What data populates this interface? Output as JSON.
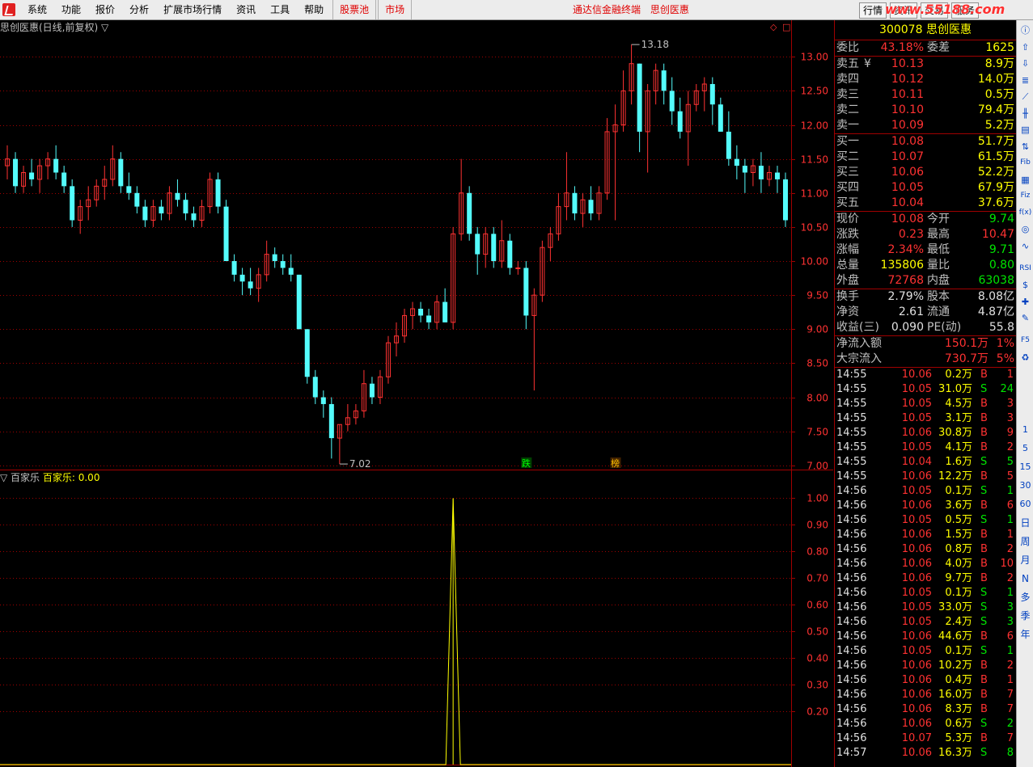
{
  "menu": {
    "items": [
      "系统",
      "功能",
      "报价",
      "分析",
      "扩展市场行情",
      "资讯",
      "工具",
      "帮助"
    ],
    "highlight_items": [
      "股票池",
      "市场"
    ],
    "center_text": [
      "通达信金融终端",
      "思创医惠"
    ],
    "right_buttons": [
      "行情",
      "资讯",
      "交易",
      "服务"
    ],
    "watermark": "www.55188.com"
  },
  "chart": {
    "title": "思创医惠(日线,前复权) ▽",
    "sub_title_prefix": "▽ 百家乐",
    "sub_title_value": "百家乐: 0.00",
    "high_mark": "13.18",
    "low_mark": "7.02",
    "mark_die": "跌",
    "mark_bang": "榜",
    "price_axis": [
      "13.00",
      "12.50",
      "12.00",
      "11.50",
      "11.00",
      "10.50",
      "10.00",
      "9.50",
      "9.00",
      "8.50",
      "8.00",
      "7.50",
      "7.00"
    ],
    "sub_axis": [
      "1.00",
      "0.90",
      "0.80",
      "0.70",
      "0.60",
      "0.50",
      "0.40",
      "0.30",
      "0.20"
    ]
  },
  "chart_data": {
    "type": "candlestick",
    "price_range": [
      6.95,
      13.3
    ],
    "candles": [
      [
        11.4,
        11.7,
        11.2,
        11.5
      ],
      [
        11.5,
        11.6,
        11.0,
        11.1
      ],
      [
        11.1,
        11.4,
        11.0,
        11.3
      ],
      [
        11.3,
        11.5,
        11.1,
        11.2
      ],
      [
        11.2,
        11.5,
        11.0,
        11.4
      ],
      [
        11.4,
        11.6,
        11.2,
        11.5
      ],
      [
        11.5,
        11.7,
        11.2,
        11.3
      ],
      [
        11.3,
        11.4,
        11.0,
        11.1
      ],
      [
        11.1,
        11.2,
        10.5,
        10.6
      ],
      [
        10.6,
        10.9,
        10.4,
        10.8
      ],
      [
        10.8,
        11.1,
        10.6,
        10.9
      ],
      [
        10.9,
        11.2,
        10.8,
        11.1
      ],
      [
        11.1,
        11.4,
        10.9,
        11.2
      ],
      [
        11.2,
        11.7,
        11.1,
        11.5
      ],
      [
        11.5,
        11.6,
        11.0,
        11.1
      ],
      [
        11.1,
        11.3,
        10.9,
        11.0
      ],
      [
        11.0,
        11.1,
        10.7,
        10.8
      ],
      [
        10.8,
        10.9,
        10.5,
        10.6
      ],
      [
        10.6,
        10.9,
        10.5,
        10.8
      ],
      [
        10.8,
        10.9,
        10.6,
        10.7
      ],
      [
        10.7,
        11.1,
        10.6,
        11.0
      ],
      [
        11.0,
        11.2,
        10.8,
        10.9
      ],
      [
        10.9,
        11.0,
        10.6,
        10.7
      ],
      [
        10.7,
        10.8,
        10.5,
        10.6
      ],
      [
        10.6,
        10.9,
        10.5,
        10.8
      ],
      [
        10.8,
        11.3,
        10.7,
        11.2
      ],
      [
        11.2,
        11.3,
        10.7,
        10.8
      ],
      [
        10.8,
        10.9,
        10.0,
        10.0
      ],
      [
        10.0,
        10.1,
        9.7,
        9.8
      ],
      [
        9.8,
        9.9,
        9.5,
        9.7
      ],
      [
        9.7,
        9.9,
        9.5,
        9.6
      ],
      [
        9.6,
        9.9,
        9.4,
        9.8
      ],
      [
        9.8,
        10.3,
        9.7,
        10.1
      ],
      [
        10.1,
        10.2,
        9.9,
        10.0
      ],
      [
        10.0,
        10.1,
        9.8,
        9.9
      ],
      [
        9.9,
        10.1,
        9.7,
        9.8
      ],
      [
        9.8,
        9.8,
        9.0,
        9.0
      ],
      [
        9.0,
        9.0,
        8.2,
        8.3
      ],
      [
        8.3,
        8.4,
        7.9,
        8.0
      ],
      [
        8.0,
        8.1,
        7.7,
        7.9
      ],
      [
        7.9,
        8.0,
        7.1,
        7.4
      ],
      [
        7.4,
        7.6,
        7.02,
        7.6
      ],
      [
        7.6,
        7.9,
        7.5,
        7.7
      ],
      [
        7.7,
        7.9,
        7.6,
        7.8
      ],
      [
        7.8,
        8.4,
        7.7,
        8.2
      ],
      [
        8.2,
        8.3,
        7.9,
        8.0
      ],
      [
        8.0,
        8.4,
        7.9,
        8.3
      ],
      [
        8.3,
        8.9,
        8.2,
        8.8
      ],
      [
        8.8,
        9.1,
        8.6,
        8.9
      ],
      [
        8.9,
        9.3,
        8.8,
        9.2
      ],
      [
        9.2,
        9.4,
        9.0,
        9.3
      ],
      [
        9.3,
        9.4,
        9.1,
        9.2
      ],
      [
        9.2,
        9.3,
        9.0,
        9.1
      ],
      [
        9.1,
        9.5,
        9.0,
        9.4
      ],
      [
        9.4,
        9.6,
        9.1,
        9.1
      ],
      [
        9.1,
        10.5,
        9.0,
        10.4
      ],
      [
        10.4,
        11.5,
        10.3,
        11.0
      ],
      [
        11.0,
        11.1,
        10.3,
        10.4
      ],
      [
        10.4,
        10.5,
        9.8,
        10.1
      ],
      [
        10.1,
        10.5,
        9.9,
        10.4
      ],
      [
        10.4,
        10.5,
        9.9,
        10.0
      ],
      [
        10.0,
        10.6,
        9.9,
        10.3
      ],
      [
        10.3,
        10.4,
        9.8,
        9.9
      ],
      [
        9.9,
        10.0,
        9.8,
        9.9
      ],
      [
        9.9,
        10.0,
        9.0,
        9.2
      ],
      [
        9.2,
        9.6,
        8.1,
        9.5
      ],
      [
        9.5,
        10.3,
        9.4,
        10.2
      ],
      [
        10.2,
        10.5,
        10.0,
        10.4
      ],
      [
        10.4,
        11.0,
        10.3,
        10.8
      ],
      [
        10.8,
        11.6,
        10.6,
        11.0
      ],
      [
        11.0,
        11.1,
        10.6,
        10.7
      ],
      [
        10.7,
        11.0,
        10.5,
        10.9
      ],
      [
        10.9,
        11.1,
        10.6,
        10.7
      ],
      [
        10.7,
        11.1,
        10.6,
        11.0
      ],
      [
        11.0,
        12.1,
        10.9,
        11.9
      ],
      [
        11.9,
        12.3,
        10.6,
        12.0
      ],
      [
        12.0,
        12.8,
        11.9,
        12.5
      ],
      [
        12.5,
        13.18,
        12.3,
        12.9
      ],
      [
        12.9,
        12.9,
        11.6,
        11.9
      ],
      [
        11.9,
        12.6,
        11.3,
        12.5
      ],
      [
        12.5,
        12.9,
        12.3,
        12.8
      ],
      [
        12.8,
        12.9,
        12.3,
        12.5
      ],
      [
        12.5,
        12.7,
        12.0,
        12.2
      ],
      [
        12.2,
        12.4,
        11.8,
        11.9
      ],
      [
        11.9,
        12.5,
        11.4,
        12.3
      ],
      [
        12.3,
        12.6,
        12.2,
        12.5
      ],
      [
        12.5,
        12.7,
        12.2,
        12.6
      ],
      [
        12.6,
        12.7,
        12.0,
        12.3
      ],
      [
        12.3,
        12.4,
        11.9,
        11.9
      ],
      [
        11.9,
        12.2,
        11.4,
        11.5
      ],
      [
        11.5,
        11.7,
        11.2,
        11.4
      ],
      [
        11.4,
        11.5,
        11.0,
        11.3
      ],
      [
        11.3,
        11.5,
        11.1,
        11.4
      ],
      [
        11.4,
        11.6,
        11.0,
        11.2
      ],
      [
        11.2,
        11.4,
        11.1,
        11.3
      ],
      [
        11.3,
        11.4,
        11.0,
        11.2
      ],
      [
        11.2,
        11.3,
        10.5,
        10.6
      ]
    ],
    "indicator_spike": {
      "index": 55,
      "value": 1.0
    },
    "indicator_range": [
      0,
      1.05
    ]
  },
  "quote": {
    "code": "300078",
    "name": "思创医惠",
    "weibi_label": "委比",
    "weibi_value": "43.18%",
    "weicha_label": "委差",
    "weicha_value": "1625",
    "sells": [
      {
        "label": "卖五",
        "mark": "¥",
        "price": "10.13",
        "vol": "8.9万"
      },
      {
        "label": "卖四",
        "mark": "",
        "price": "10.12",
        "vol": "14.0万"
      },
      {
        "label": "卖三",
        "mark": "",
        "price": "10.11",
        "vol": "0.5万"
      },
      {
        "label": "卖二",
        "mark": "",
        "price": "10.10",
        "vol": "79.4万"
      },
      {
        "label": "卖一",
        "mark": "",
        "price": "10.09",
        "vol": "5.2万"
      }
    ],
    "buys": [
      {
        "label": "买一",
        "price": "10.08",
        "vol": "51.7万"
      },
      {
        "label": "买二",
        "price": "10.07",
        "vol": "61.5万"
      },
      {
        "label": "买三",
        "price": "10.06",
        "vol": "52.2万"
      },
      {
        "label": "买四",
        "price": "10.05",
        "vol": "67.9万"
      },
      {
        "label": "买五",
        "price": "10.04",
        "vol": "37.6万"
      }
    ],
    "stats": [
      {
        "l1": "现价",
        "v1": "10.08",
        "c1": "red",
        "l2": "今开",
        "v2": "9.74",
        "c2": "green"
      },
      {
        "l1": "涨跌",
        "v1": "0.23",
        "c1": "red",
        "l2": "最高",
        "v2": "10.47",
        "c2": "red"
      },
      {
        "l1": "涨幅",
        "v1": "2.34%",
        "c1": "red",
        "l2": "最低",
        "v2": "9.71",
        "c2": "green"
      },
      {
        "l1": "总量",
        "v1": "135806",
        "c1": "yellow",
        "l2": "量比",
        "v2": "0.80",
        "c2": "green"
      },
      {
        "l1": "外盘",
        "v1": "72768",
        "c1": "red",
        "l2": "内盘",
        "v2": "63038",
        "c2": "green"
      }
    ],
    "stats2": [
      {
        "l1": "换手",
        "v1": "2.79%",
        "l2": "股本",
        "v2": "8.08亿"
      },
      {
        "l1": "净资",
        "v1": "2.61",
        "l2": "流通",
        "v2": "4.87亿"
      },
      {
        "l1": "收益(三)",
        "v1": "0.090",
        "l2": "PE(动)",
        "v2": "55.8"
      }
    ],
    "flow": [
      {
        "label": "净流入额",
        "value": "150.1万",
        "pct": "1%"
      },
      {
        "label": "大宗流入",
        "value": "730.7万",
        "pct": "5%"
      }
    ],
    "ticks": [
      {
        "t": "14:55",
        "p": "10.06",
        "v": "0.2万",
        "d": "B",
        "n": "1"
      },
      {
        "t": "14:55",
        "p": "10.05",
        "v": "31.0万",
        "d": "S",
        "n": "24"
      },
      {
        "t": "14:55",
        "p": "10.05",
        "v": "4.5万",
        "d": "B",
        "n": "3"
      },
      {
        "t": "14:55",
        "p": "10.05",
        "v": "3.1万",
        "d": "B",
        "n": "3"
      },
      {
        "t": "14:55",
        "p": "10.06",
        "v": "30.8万",
        "d": "B",
        "n": "9"
      },
      {
        "t": "14:55",
        "p": "10.05",
        "v": "4.1万",
        "d": "B",
        "n": "2"
      },
      {
        "t": "14:55",
        "p": "10.04",
        "v": "1.6万",
        "d": "S",
        "n": "5"
      },
      {
        "t": "14:55",
        "p": "10.06",
        "v": "12.2万",
        "d": "B",
        "n": "5"
      },
      {
        "t": "14:56",
        "p": "10.05",
        "v": "0.1万",
        "d": "S",
        "n": "1"
      },
      {
        "t": "14:56",
        "p": "10.06",
        "v": "3.6万",
        "d": "B",
        "n": "6"
      },
      {
        "t": "14:56",
        "p": "10.05",
        "v": "0.5万",
        "d": "S",
        "n": "1"
      },
      {
        "t": "14:56",
        "p": "10.06",
        "v": "1.5万",
        "d": "B",
        "n": "1"
      },
      {
        "t": "14:56",
        "p": "10.06",
        "v": "0.8万",
        "d": "B",
        "n": "2"
      },
      {
        "t": "14:56",
        "p": "10.06",
        "v": "4.0万",
        "d": "B",
        "n": "10"
      },
      {
        "t": "14:56",
        "p": "10.06",
        "v": "9.7万",
        "d": "B",
        "n": "2"
      },
      {
        "t": "14:56",
        "p": "10.05",
        "v": "0.1万",
        "d": "S",
        "n": "1"
      },
      {
        "t": "14:56",
        "p": "10.05",
        "v": "33.0万",
        "d": "S",
        "n": "3"
      },
      {
        "t": "14:56",
        "p": "10.05",
        "v": "2.4万",
        "d": "S",
        "n": "3"
      },
      {
        "t": "14:56",
        "p": "10.06",
        "v": "44.6万",
        "d": "B",
        "n": "6"
      },
      {
        "t": "14:56",
        "p": "10.05",
        "v": "0.1万",
        "d": "S",
        "n": "1"
      },
      {
        "t": "14:56",
        "p": "10.06",
        "v": "10.2万",
        "d": "B",
        "n": "2"
      },
      {
        "t": "14:56",
        "p": "10.06",
        "v": "0.4万",
        "d": "B",
        "n": "1"
      },
      {
        "t": "14:56",
        "p": "10.06",
        "v": "16.0万",
        "d": "B",
        "n": "7"
      },
      {
        "t": "14:56",
        "p": "10.06",
        "v": "8.3万",
        "d": "B",
        "n": "7"
      },
      {
        "t": "14:56",
        "p": "10.06",
        "v": "0.6万",
        "d": "S",
        "n": "2"
      },
      {
        "t": "14:56",
        "p": "10.07",
        "v": "5.3万",
        "d": "B",
        "n": "7"
      },
      {
        "t": "14:57",
        "p": "10.06",
        "v": "16.3万",
        "d": "S",
        "n": "8"
      }
    ]
  },
  "toolbar": {
    "periods": [
      "1",
      "5",
      "15",
      "30",
      "60"
    ],
    "period_words": [
      "日",
      "周",
      "月",
      "N",
      "多",
      "季",
      "年"
    ],
    "icons": [
      "info-icon",
      "up-arrow-icon",
      "down-arrow-icon",
      "list-icon",
      "line-chart-icon",
      "kline-icon",
      "grid-icon",
      "sort-icon",
      "fib-icon",
      "calendar-icon",
      "fiz-icon",
      "fx-icon",
      "circle-icon",
      "wave-icon",
      "rsi-icon",
      "money-icon",
      "cross-icon",
      "pencil-icon",
      "f5-icon",
      "recycle-icon"
    ],
    "icon_labels": {
      "fib": "Fib",
      "fiz": "Fiz",
      "fx": "f(x)",
      "rsi": "RSI",
      "f5": "F5"
    }
  },
  "colors": {
    "up": "#ff3232",
    "down": "#54fcfc",
    "grid": "#a00000",
    "indicator": "#ffff00"
  }
}
